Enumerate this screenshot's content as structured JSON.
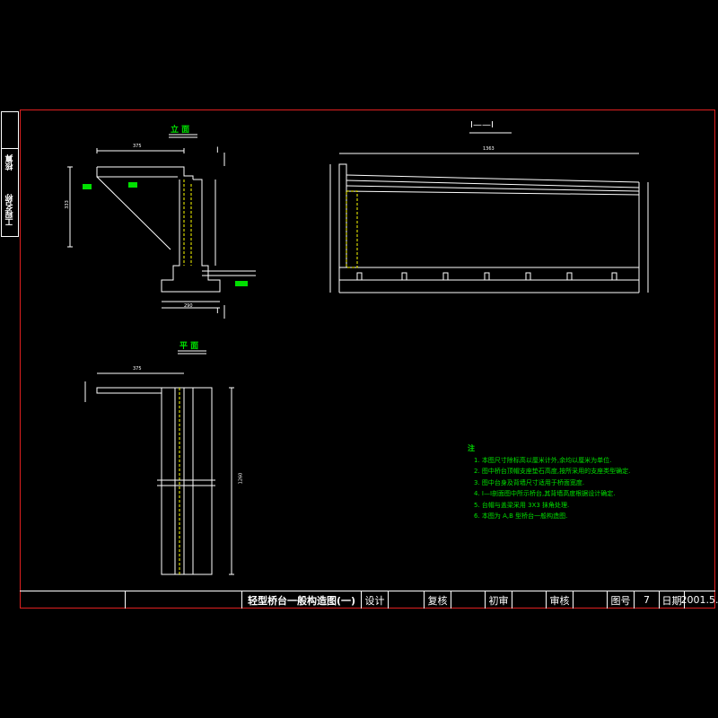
{
  "side_tab": {
    "top_label": "核算",
    "bottom_label": "工程名称"
  },
  "views": {
    "elevation_title": "立 面",
    "section_title": "I——I",
    "plan_title": "平 面",
    "section_mark": "I"
  },
  "notes": {
    "heading": "注",
    "items": [
      "1. 本图尺寸除标高以厘米计外,余均以厘米为单位.",
      "2. 图中桥台顶帽支座垫石高度,按所采用的支座类型确定.",
      "3. 图中台身及背墙尺寸适用于桥面宽度.",
      "4. I—I剖面图中所示桥台,其背墙高度根据设计确定.",
      "5. 台帽与盖梁采用 3X3 抹角处理.",
      "6. 本图为 A,B 型桥台一般构造图."
    ]
  },
  "title_block": {
    "drawing_title": "轻型桥台一般构造图(一)",
    "design_label": "设计",
    "review_label": "复核",
    "preliminary_label": "初审",
    "audit_label": "审核",
    "sheet_no_label": "图号",
    "sheet_no": "7",
    "date_label": "日期",
    "date": "2001.5."
  },
  "colors": {
    "frame": "#e02020",
    "linework": "#ffffff",
    "hidden": "#ffff00",
    "annotation": "#00e000"
  },
  "dims": {
    "elev_top": "375",
    "elev_h": "333",
    "elev_base": "290",
    "section_len": "1363",
    "plan_top": "375",
    "plan_len": "1260"
  }
}
